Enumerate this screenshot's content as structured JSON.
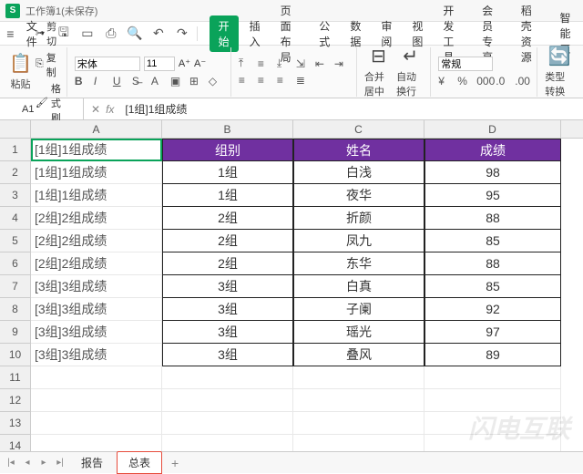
{
  "app": {
    "icon": "S",
    "title": "工作簿1(未保存)"
  },
  "menu": {
    "file": "文件",
    "tabs": [
      "开始",
      "插入",
      "页面布局",
      "公式",
      "数据",
      "审阅",
      "视图",
      "开发工具",
      "会员专享",
      "稻壳资源",
      "智能工"
    ],
    "active_tab_index": 0
  },
  "ribbon": {
    "paste": "粘贴",
    "cut": "剪切",
    "copy": "复制",
    "format_painter": "格式刷",
    "font_name": "宋体",
    "font_size": "11",
    "merge": "合并居中",
    "wrap": "自动换行",
    "general": "常规",
    "type_convert": "类型转换"
  },
  "cellref": {
    "name": "A1",
    "formula": "[1组]1组成绩"
  },
  "columns": [
    "A",
    "B",
    "C",
    "D"
  ],
  "chart_data": {
    "type": "table",
    "headers": [
      "组别",
      "姓名",
      "成绩"
    ],
    "rows": [
      {
        "colA": "[1组]1组成绩",
        "group": "1组",
        "name": "白浅",
        "score": 98
      },
      {
        "colA": "[1组]1组成绩",
        "group": "1组",
        "name": "夜华",
        "score": 95
      },
      {
        "colA": "[2组]2组成绩",
        "group": "2组",
        "name": "折颜",
        "score": 88
      },
      {
        "colA": "[2组]2组成绩",
        "group": "2组",
        "name": "凤九",
        "score": 85
      },
      {
        "colA": "[2组]2组成绩",
        "group": "2组",
        "name": "东华",
        "score": 88
      },
      {
        "colA": "[3组]3组成绩",
        "group": "3组",
        "name": "白真",
        "score": 85
      },
      {
        "colA": "[3组]3组成绩",
        "group": "3组",
        "name": "子阑",
        "score": 92
      },
      {
        "colA": "[3组]3组成绩",
        "group": "3组",
        "name": "瑶光",
        "score": 97
      },
      {
        "colA": "[3组]3组成绩",
        "group": "3组",
        "name": "叠风",
        "score": 89
      }
    ],
    "a1": "[1组]1组成绩"
  },
  "sheets": {
    "tabs": [
      "报告",
      "总表"
    ],
    "active_index": 1
  },
  "watermark": "闪电互联"
}
